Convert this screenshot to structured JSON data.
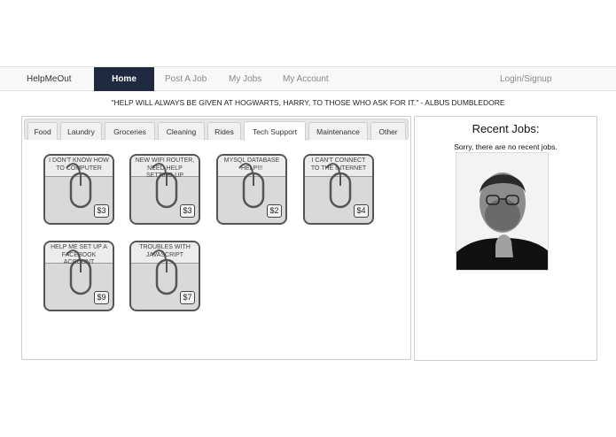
{
  "nav": {
    "brand": "HelpMeOut",
    "items": [
      {
        "label": "Home",
        "active": true
      },
      {
        "label": "Post A Job",
        "active": false
      },
      {
        "label": "My Jobs",
        "active": false
      },
      {
        "label": "My Account",
        "active": false
      }
    ],
    "login": "Login/Signup",
    "active_bg": "#1f2a40"
  },
  "quote": "\"HELP WILL ALWAYS BE GIVEN AT HOGWARTS, HARRY, TO THOSE WHO ASK FOR IT.\" - ALBUS DUMBLEDORE",
  "tabs": [
    "Food",
    "Laundry",
    "Groceries",
    "Cleaning",
    "Rides",
    "Tech Support",
    "Maintenance",
    "Other"
  ],
  "active_tab": "Tech Support",
  "jobs": [
    {
      "title": "I DON'T KNOW HOW TO COMPUTER",
      "price": "$3",
      "icon": "computer-mouse-icon"
    },
    {
      "title": "NEW WIFI ROUTER, NEED HELP SETTING UP",
      "price": "$3",
      "icon": "computer-mouse-icon"
    },
    {
      "title": "MYSQL DATABASE HELP!!!",
      "price": "$2",
      "icon": "computer-mouse-icon"
    },
    {
      "title": "I CAN'T CONNECT TO THE INTERNET",
      "price": "$4",
      "icon": "computer-mouse-icon"
    },
    {
      "title": "HELP ME SET UP A FACEBOOK ACCOUNT",
      "price": "$9",
      "icon": "computer-mouse-icon"
    },
    {
      "title": "TROUBLES WITH JAVASCRIPT",
      "price": "$7",
      "icon": "computer-mouse-icon"
    }
  ],
  "recent": {
    "title": "Recent Jobs:",
    "message": "Sorry, there are no recent jobs."
  }
}
